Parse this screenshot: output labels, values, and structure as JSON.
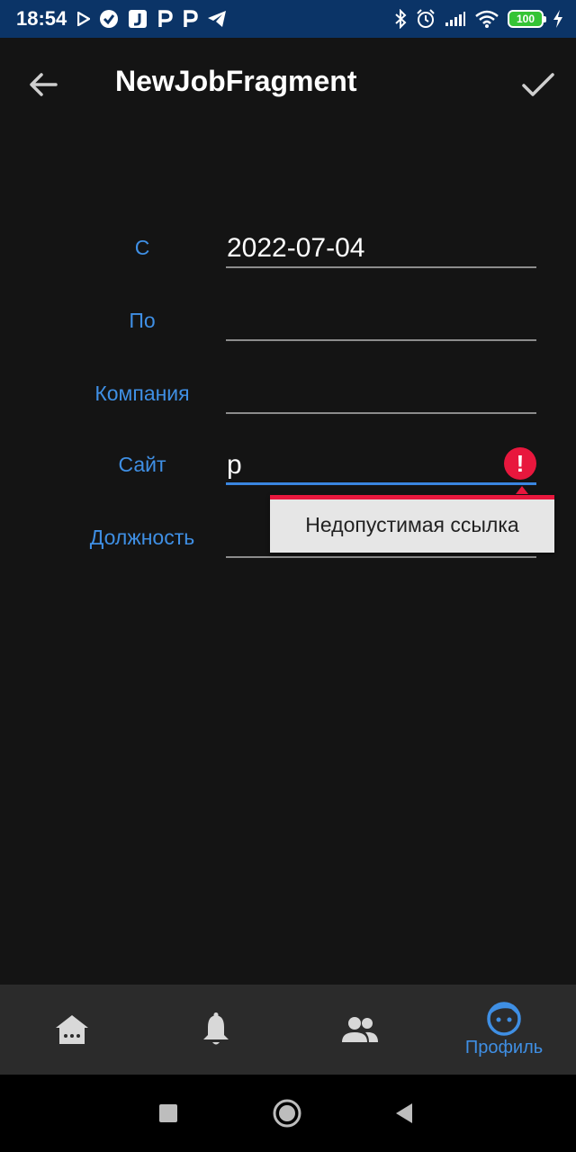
{
  "status_bar": {
    "time": "18:54",
    "battery": "100",
    "notification_icons": [
      "play-store-icon",
      "check-circle-icon",
      "j-app-icon",
      "p-app-icon",
      "p-app-icon",
      "telegram-icon"
    ],
    "system_icons": [
      "bluetooth-icon",
      "alarm-icon",
      "signal-icon",
      "wifi-icon",
      "battery-icon",
      "charging-icon"
    ]
  },
  "app_bar": {
    "title": "NewJobFragment",
    "back_icon": "arrow-back-icon",
    "confirm_icon": "check-icon"
  },
  "form": {
    "start": {
      "label": "С",
      "value": "2022-07-04"
    },
    "end": {
      "label": "По",
      "value": ""
    },
    "company": {
      "label": "Компания",
      "value": ""
    },
    "site": {
      "label": "Сайт",
      "value": "p",
      "error": "Недопустимая ссылка"
    },
    "position": {
      "label": "Должность",
      "value": ""
    }
  },
  "bottom_nav": {
    "items": [
      {
        "icon": "home-icon",
        "label": ""
      },
      {
        "icon": "bell-icon",
        "label": ""
      },
      {
        "icon": "people-icon",
        "label": ""
      },
      {
        "icon": "face-icon",
        "label": "Профиль",
        "active": true
      }
    ]
  },
  "colors": {
    "accent": "#3f8fe4",
    "error": "#e8173d",
    "background": "#141414",
    "status_bar": "#0b3467"
  }
}
